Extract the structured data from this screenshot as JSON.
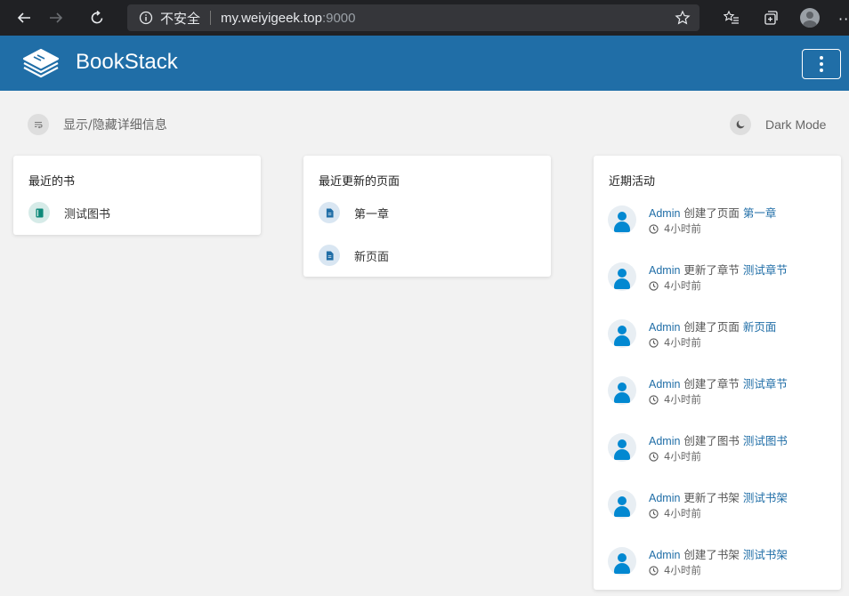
{
  "browser": {
    "insecure_label": "不安全",
    "host": "my.weiyigeek.top",
    "port": ":9000",
    "more": "··"
  },
  "app": {
    "brand": "BookStack",
    "accent": "#206ea7"
  },
  "actions": {
    "toggle_details": "显示/隐藏详细信息",
    "dark_mode": "Dark Mode"
  },
  "recent_books": {
    "title": "最近的书",
    "items": [
      {
        "name": "测试图书",
        "icon": "book-icon"
      }
    ]
  },
  "recent_pages": {
    "title": "最近更新的页面",
    "items": [
      {
        "name": "第一章",
        "icon": "page-icon"
      },
      {
        "name": "新页面",
        "icon": "page-icon"
      }
    ]
  },
  "activity": {
    "title": "近期活动",
    "items": [
      {
        "user": "Admin",
        "action": "创建了页面",
        "target": "第一章",
        "time": "4小时前"
      },
      {
        "user": "Admin",
        "action": "更新了章节",
        "target": "测试章节",
        "time": "4小时前"
      },
      {
        "user": "Admin",
        "action": "创建了页面",
        "target": "新页面",
        "time": "4小时前"
      },
      {
        "user": "Admin",
        "action": "创建了章节",
        "target": "测试章节",
        "time": "4小时前"
      },
      {
        "user": "Admin",
        "action": "创建了图书",
        "target": "测试图书",
        "time": "4小时前"
      },
      {
        "user": "Admin",
        "action": "更新了书架",
        "target": "测试书架",
        "time": "4小时前"
      },
      {
        "user": "Admin",
        "action": "创建了书架",
        "target": "测试书架",
        "time": "4小时前"
      }
    ]
  }
}
